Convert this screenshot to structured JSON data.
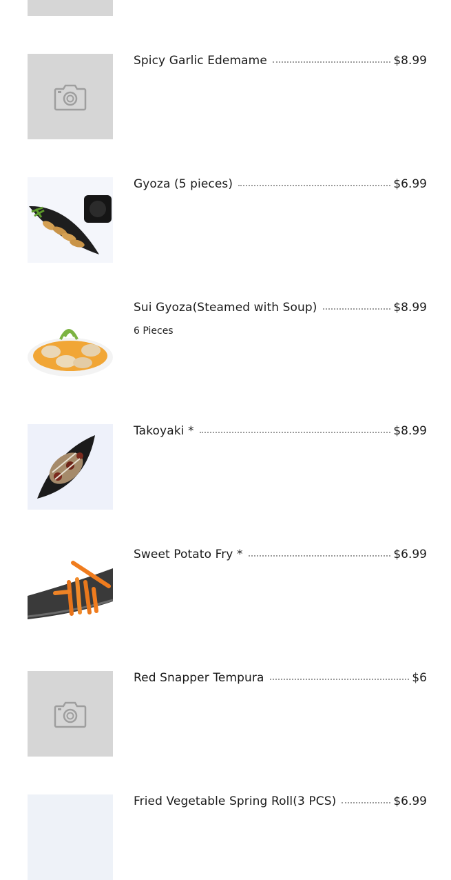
{
  "items": [
    {
      "name": "",
      "price": "",
      "description": "",
      "image": "placeholder"
    },
    {
      "name": "Spicy Garlic Edemame",
      "price": "$8.99",
      "description": "",
      "image": "placeholder"
    },
    {
      "name": "Gyoza (5 pieces)",
      "price": "$6.99",
      "description": "",
      "image": "gyoza-plate"
    },
    {
      "name": "Sui Gyoza(Steamed with Soup)",
      "price": "$8.99",
      "description": "6 Pieces",
      "image": "sui-gyoza"
    },
    {
      "name": "Takoyaki *",
      "price": "$8.99",
      "description": "",
      "image": "takoyaki"
    },
    {
      "name": "Sweet Potato Fry *",
      "price": "$6.99",
      "description": "",
      "image": "sweet-potato-fry"
    },
    {
      "name": "Red Snapper Tempura",
      "price": "$6",
      "description": "",
      "image": "placeholder"
    },
    {
      "name": "Fried Vegetable Spring Roll(3 PCS)",
      "price": "$6.99",
      "description": "",
      "image": "photo"
    }
  ]
}
